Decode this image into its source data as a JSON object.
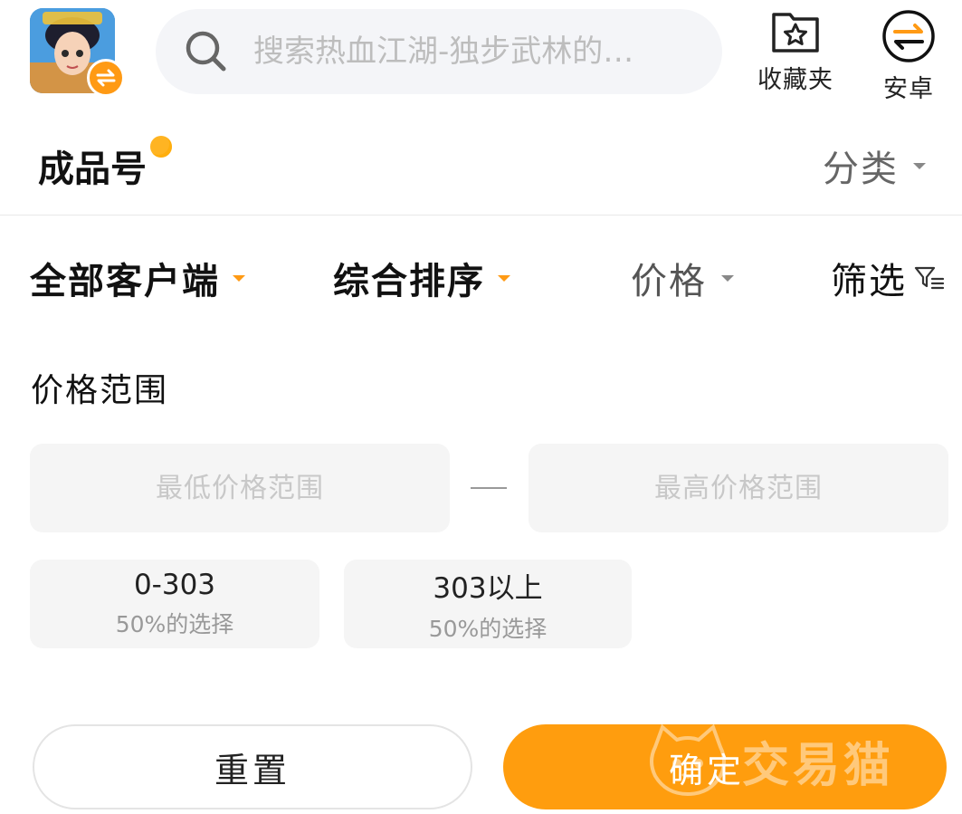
{
  "header": {
    "search_placeholder": "搜索热血江湖-独步武林的…",
    "favorites_label": "收藏夹",
    "platform_label": "安卓"
  },
  "title_row": {
    "title": "成品号",
    "category_label": "分类"
  },
  "filter_bar": {
    "client_label": "全部客户端",
    "sort_label": "综合排序",
    "price_label": "价格",
    "filter_label": "筛选"
  },
  "price_panel": {
    "section_title": "价格范围",
    "min_placeholder": "最低价格范围",
    "max_placeholder": "最高价格范围",
    "chips": [
      {
        "range": "0-303",
        "share": "50%的选择"
      },
      {
        "range": "303以上",
        "share": "50%的选择"
      }
    ]
  },
  "actions": {
    "reset_label": "重置",
    "confirm_label": "确定"
  },
  "watermark": {
    "text": "交易猫"
  },
  "colors": {
    "accent": "#ff9d0e",
    "input_bg": "#f5f5f5",
    "search_bg": "#f4f5f8",
    "muted_text": "#999999"
  },
  "icons": [
    "swap-icon",
    "search-icon",
    "star-folder-icon",
    "android-swap-icon",
    "filter-funnel-icon",
    "cat-logo-icon"
  ]
}
